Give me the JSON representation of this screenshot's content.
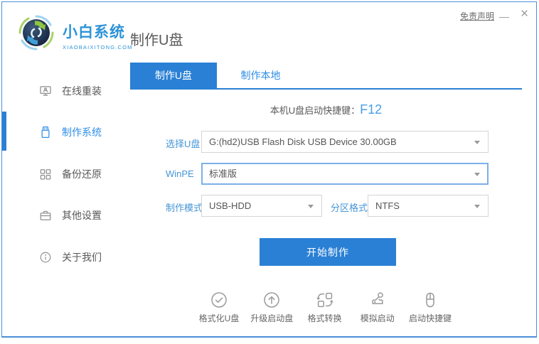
{
  "window": {
    "disclaimer": "免责声明",
    "minimize": "—",
    "close": "×"
  },
  "header": {
    "logo_title": "小白系统",
    "logo_subtitle": "XIAOBAIXITONG.COM",
    "page_title": "制作U盘"
  },
  "sidebar": {
    "items": [
      {
        "label": "在线重装",
        "icon": "monitor-user-icon",
        "active": false
      },
      {
        "label": "制作系统",
        "icon": "usb-drive-icon",
        "active": true
      },
      {
        "label": "备份还原",
        "icon": "backup-grid-icon",
        "active": false
      },
      {
        "label": "其他设置",
        "icon": "briefcase-icon",
        "active": false
      },
      {
        "label": "关于我们",
        "icon": "info-icon",
        "active": false
      }
    ]
  },
  "tabs": [
    {
      "label": "制作U盘",
      "active": true
    },
    {
      "label": "制作本地",
      "active": false
    }
  ],
  "main": {
    "hotkey_label": "本机U盘启动快捷键：",
    "hotkey_value": "F12",
    "form": {
      "usb_label": "选择U盘",
      "usb_value": "G:(hd2)USB Flash Disk USB Device 30.00GB",
      "winpe_label": "WinPE",
      "winpe_value": "标准版",
      "mode_label": "制作模式",
      "mode_value": "USB-HDD",
      "partition_label": "分区格式",
      "partition_value": "NTFS"
    },
    "start_button": "开始制作",
    "tools": [
      {
        "label": "格式化U盘",
        "icon": "check-circle-icon"
      },
      {
        "label": "升级启动盘",
        "icon": "arrow-up-circle-icon"
      },
      {
        "label": "格式转换",
        "icon": "format-convert-icon"
      },
      {
        "label": "模拟启动",
        "icon": "stamp-icon"
      },
      {
        "label": "启动快捷键",
        "icon": "mouse-icon"
      }
    ]
  },
  "colors": {
    "primary_blue": "#2a80d5",
    "link_blue": "#2e8ee6",
    "label_blue": "#4595d6",
    "focus_border": "#7cb0e8",
    "border_gray": "#d5d5d5",
    "text_gray": "#595959",
    "icon_gray": "#9a9a9a"
  }
}
